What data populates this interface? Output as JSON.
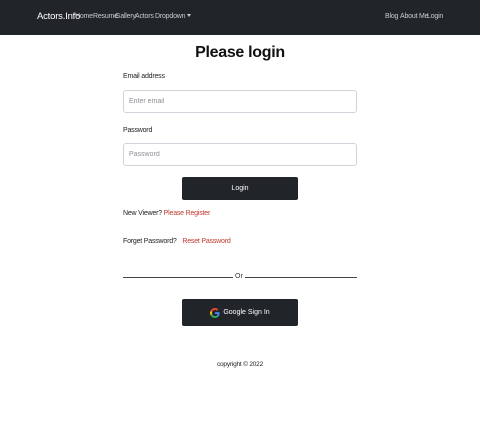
{
  "navbar": {
    "brand": "Actors.Info",
    "links": [
      "Home",
      "Resume",
      "Gallery",
      "Actors"
    ],
    "dropdown": "Dropdown",
    "right_links": [
      "Blog",
      "About Me",
      "Login"
    ]
  },
  "page": {
    "title": "Please login"
  },
  "form": {
    "email_label": "Email address",
    "email_placeholder": "Enter email",
    "password_label": "Password",
    "password_placeholder": "Password",
    "login_button": "Login",
    "new_viewer_text": "New Viewer?",
    "register_link": "Please Register",
    "forget_text": "Forget Password?",
    "reset_link": "Reset Password",
    "or_text": "Or",
    "google_button": "Google Sign In"
  },
  "footer": {
    "copyright": "copyright © 2022"
  },
  "colors": {
    "navbar": "#212529",
    "link": "#c0392b",
    "button": "#212529"
  },
  "icons": {
    "google": "google-logo-icon",
    "dropdown": "caret-down-icon"
  }
}
